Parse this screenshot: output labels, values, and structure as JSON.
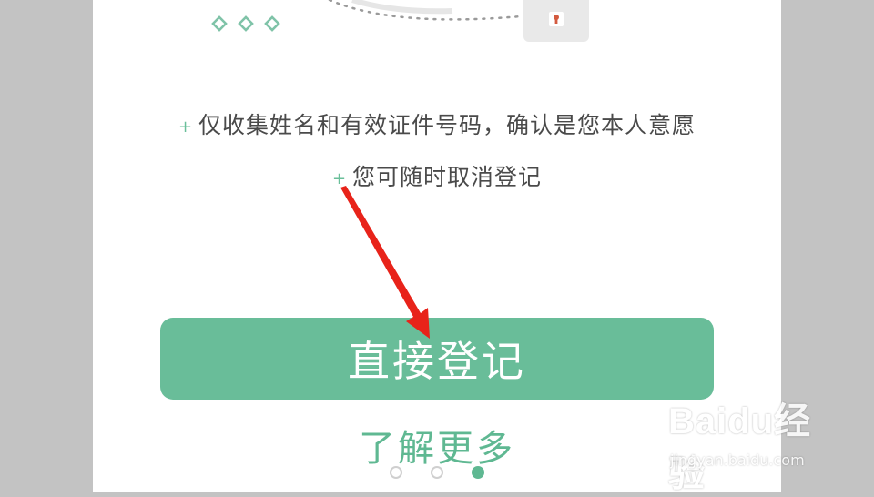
{
  "info": {
    "line1": "仅收集姓名和有效证件号码，确认是您本人意愿",
    "line2": "您可随时取消登记",
    "bullet_symbol": "+"
  },
  "actions": {
    "primary_label": "直接登记",
    "secondary_label": "了解更多"
  },
  "pager": {
    "total": 3,
    "active_index": 2
  },
  "watermark": {
    "brand": "Baidu经验",
    "url": "jingyan.baidu.com"
  },
  "colors": {
    "accent": "#69bd99",
    "link": "#5fb892",
    "text": "#4a4a4a",
    "arrow": "#e8231a",
    "outer_background": "#c3c3c3"
  },
  "icons": [
    "keyhole-icon",
    "diamond-icon",
    "plus-icon",
    "annotation-arrow",
    "page-dot"
  ]
}
